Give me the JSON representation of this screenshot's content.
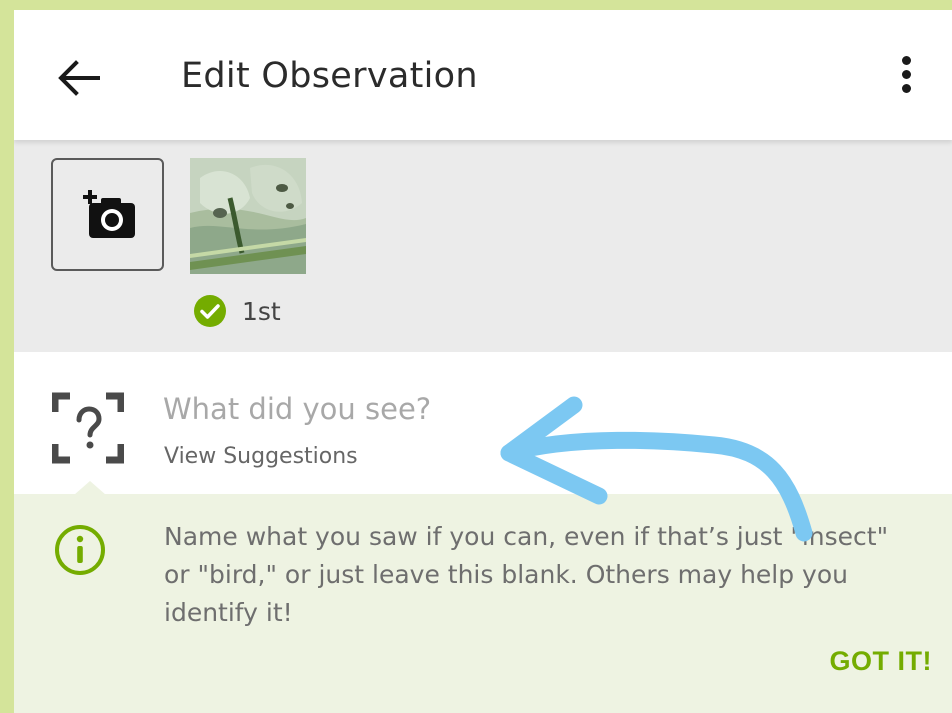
{
  "header": {
    "title": "Edit Observation",
    "back_icon": "arrow-left-icon",
    "menu_icon": "more-vertical-icon"
  },
  "photos": {
    "add_icon": "add-photo-camera-icon",
    "items": [
      {
        "label": "1st",
        "status_icon": "check-circle-icon"
      }
    ]
  },
  "species": {
    "icon": "unknown-species-icon",
    "placeholder": "What did you see?",
    "suggestions_label": "View Suggestions"
  },
  "tip": {
    "icon": "info-icon",
    "text": "Name what you saw if you can, even if that’s just \"insect\" or \"bird,\" or just leave this blank. Others may help you identify it!",
    "dismiss_label": "GOT IT!"
  },
  "colors": {
    "accent": "#74ac00",
    "tip_background": "#eef3e2",
    "annotation_arrow": "#7cc8f2",
    "frame": "#d4e49a"
  }
}
